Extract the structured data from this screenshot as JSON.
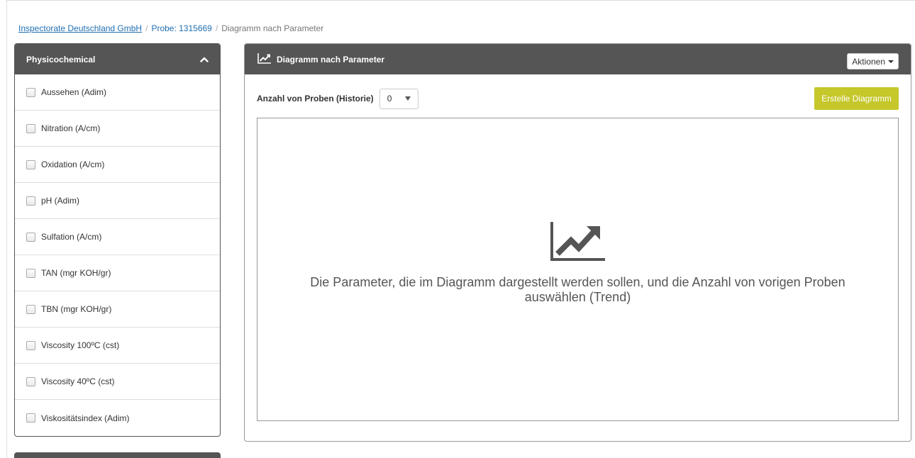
{
  "breadcrumb": {
    "company": "Inspectorate Deutschland GmbH",
    "sample": "Probe: 1315669",
    "current": "Diagramm nach Parameter",
    "separator": "/"
  },
  "left_panel": {
    "title": "Physicochemical",
    "items": [
      {
        "label": "Aussehen (Adim)"
      },
      {
        "label": "Nitration (A/cm)"
      },
      {
        "label": "Oxidation (A/cm)"
      },
      {
        "label": "pH (Adim)"
      },
      {
        "label": "Sulfation (A/cm)"
      },
      {
        "label": "TAN (mgr KOH/gr)"
      },
      {
        "label": "TBN (mgr KOH/gr)"
      },
      {
        "label": "Viscosity 100ºC (cst)"
      },
      {
        "label": "Viscosity 40ºC (cst)"
      },
      {
        "label": "Viskositätsindex (Adim)"
      }
    ]
  },
  "right_panel": {
    "title": "Diagramm nach Parameter",
    "actions_label": "Aktionen",
    "history_label": "Anzahl von Proben (Historie)",
    "history_value": "0",
    "create_button": "Erstelle Diagramm",
    "placeholder_line1": "Die Parameter, die im Diagramm dargestellt werden sollen, und die Anzahl von vorigen Proben",
    "placeholder_line2": "auswählen (Trend)"
  },
  "colors": {
    "panel_header": "#555555",
    "create_button": "#c5c72a",
    "link": "#1f6fb2"
  },
  "icons": {
    "header_icon": "line-chart-icon",
    "placeholder_icon": "line-chart-icon",
    "collapse_icon": "chevron-up-icon"
  }
}
